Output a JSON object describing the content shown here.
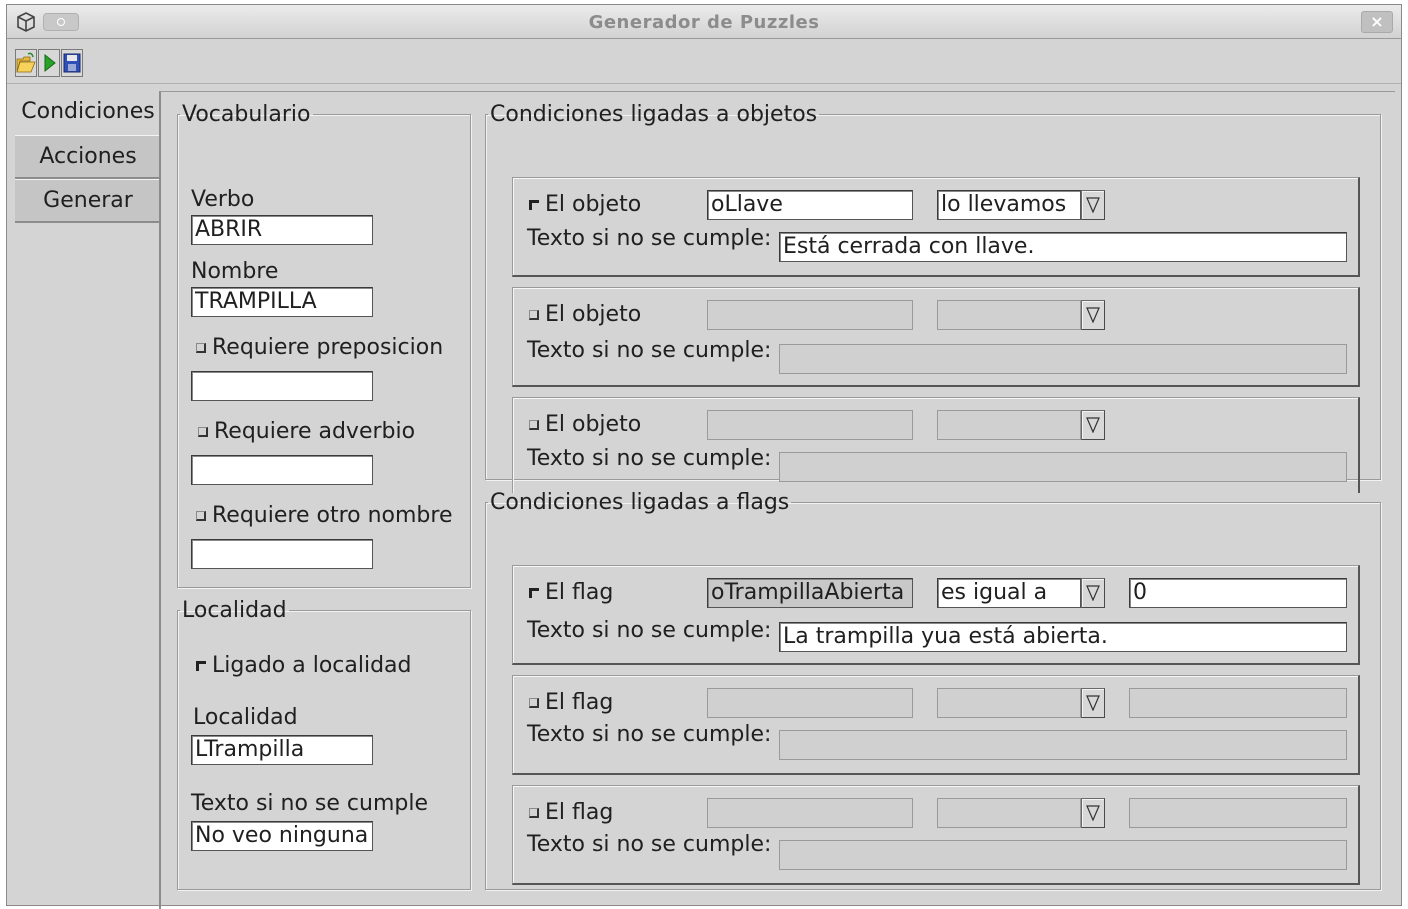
{
  "window": {
    "title": "Generador de Puzzles",
    "close_glyph": "×"
  },
  "toolbar": {
    "icons": [
      "open-folder-icon",
      "run-icon",
      "save-icon"
    ]
  },
  "tabs": [
    {
      "label": "Condiciones",
      "active": true
    },
    {
      "label": "Acciones",
      "active": false
    },
    {
      "label": "Generar",
      "active": false
    }
  ],
  "vocabulario": {
    "legend": "Vocabulario",
    "verbo_label": "Verbo",
    "verbo_value": "ABRIR",
    "nombre_label": "Nombre",
    "nombre_value": "TRAMPILLA",
    "prep_label": "Requiere preposicion",
    "prep_checked": false,
    "prep_value": "",
    "adv_label": "Requiere adverbio",
    "adv_checked": false,
    "adv_value": "",
    "otro_label": "Requiere otro nombre",
    "otro_checked": false,
    "otro_value": ""
  },
  "localidad": {
    "legend": "Localidad",
    "ligado_label": "Ligado a localidad",
    "ligado_checked": true,
    "localidad_label": "Localidad",
    "localidad_value": "LTrampilla",
    "texto_label": "Texto si no se cumple",
    "texto_value": "No veo ninguna"
  },
  "objetos": {
    "legend": "Condiciones ligadas a objetos",
    "rows": [
      {
        "check_label": "El objeto",
        "checked": true,
        "object": "oLlave",
        "condition": "lo llevamos",
        "texto_label": "Texto si no se cumple:",
        "texto": "Está cerrada con llave."
      },
      {
        "check_label": "El objeto",
        "checked": false,
        "object": "",
        "condition": "",
        "texto_label": "Texto si no se cumple:",
        "texto": ""
      },
      {
        "check_label": "El objeto",
        "checked": false,
        "object": "",
        "condition": "",
        "texto_label": "Texto si no se cumple:",
        "texto": ""
      }
    ]
  },
  "flags": {
    "legend": "Condiciones ligadas a flags",
    "rows": [
      {
        "check_label": "El flag",
        "checked": true,
        "flag": "oTrampillaAbierta",
        "condition": "es igual a",
        "value": "0",
        "texto_label": "Texto si no se cumple:",
        "texto": "La trampilla yua está abierta."
      },
      {
        "check_label": "El flag",
        "checked": false,
        "flag": "",
        "condition": "",
        "value": "",
        "texto_label": "Texto si no se cumple:",
        "texto": ""
      },
      {
        "check_label": "El flag",
        "checked": false,
        "flag": "",
        "condition": "",
        "value": "",
        "texto_label": "Texto si no se cumple:",
        "texto": ""
      }
    ]
  }
}
